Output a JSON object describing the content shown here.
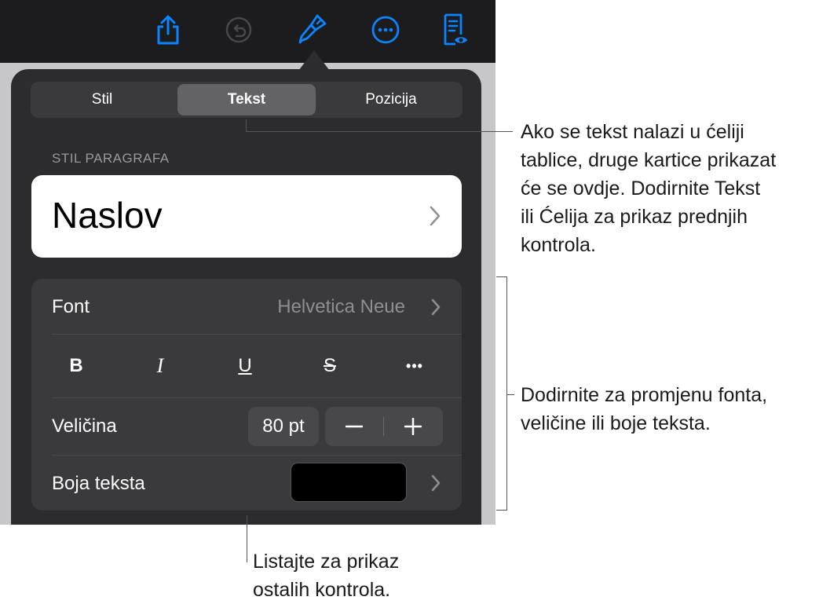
{
  "toolbar": {
    "icons": [
      "share-icon",
      "undo-icon",
      "format-brush-icon",
      "more-icon",
      "reader-view-icon"
    ],
    "accent": "#0a84ff"
  },
  "tabs": [
    {
      "label": "Stil",
      "active": false
    },
    {
      "label": "Tekst",
      "active": true
    },
    {
      "label": "Pozicija",
      "active": false
    }
  ],
  "paragraph_style": {
    "section_label": "STIL PARAGRAFA",
    "value": "Naslov"
  },
  "font_row": {
    "label": "Font",
    "value": "Helvetica Neue"
  },
  "format_buttons": [
    "B",
    "I",
    "U",
    "S",
    "•••"
  ],
  "size_row": {
    "label": "Veličina",
    "value": "80 pt",
    "minus": "−",
    "plus": "+"
  },
  "color_row": {
    "label": "Boja teksta",
    "swatch_color": "#000000"
  },
  "callouts": {
    "tabs": [
      "Ako se tekst nalazi u ćeliji",
      "tablice, druge kartice prikazat",
      "će se ovdje. Dodirnite Tekst",
      "ili Ćelija za prikaz prednjih",
      "kontrola."
    ],
    "font": [
      "Dodirnite za promjenu fonta,",
      "veličine ili boje teksta."
    ],
    "scroll": [
      "Listajte za prikaz",
      "ostalih kontrola."
    ]
  }
}
